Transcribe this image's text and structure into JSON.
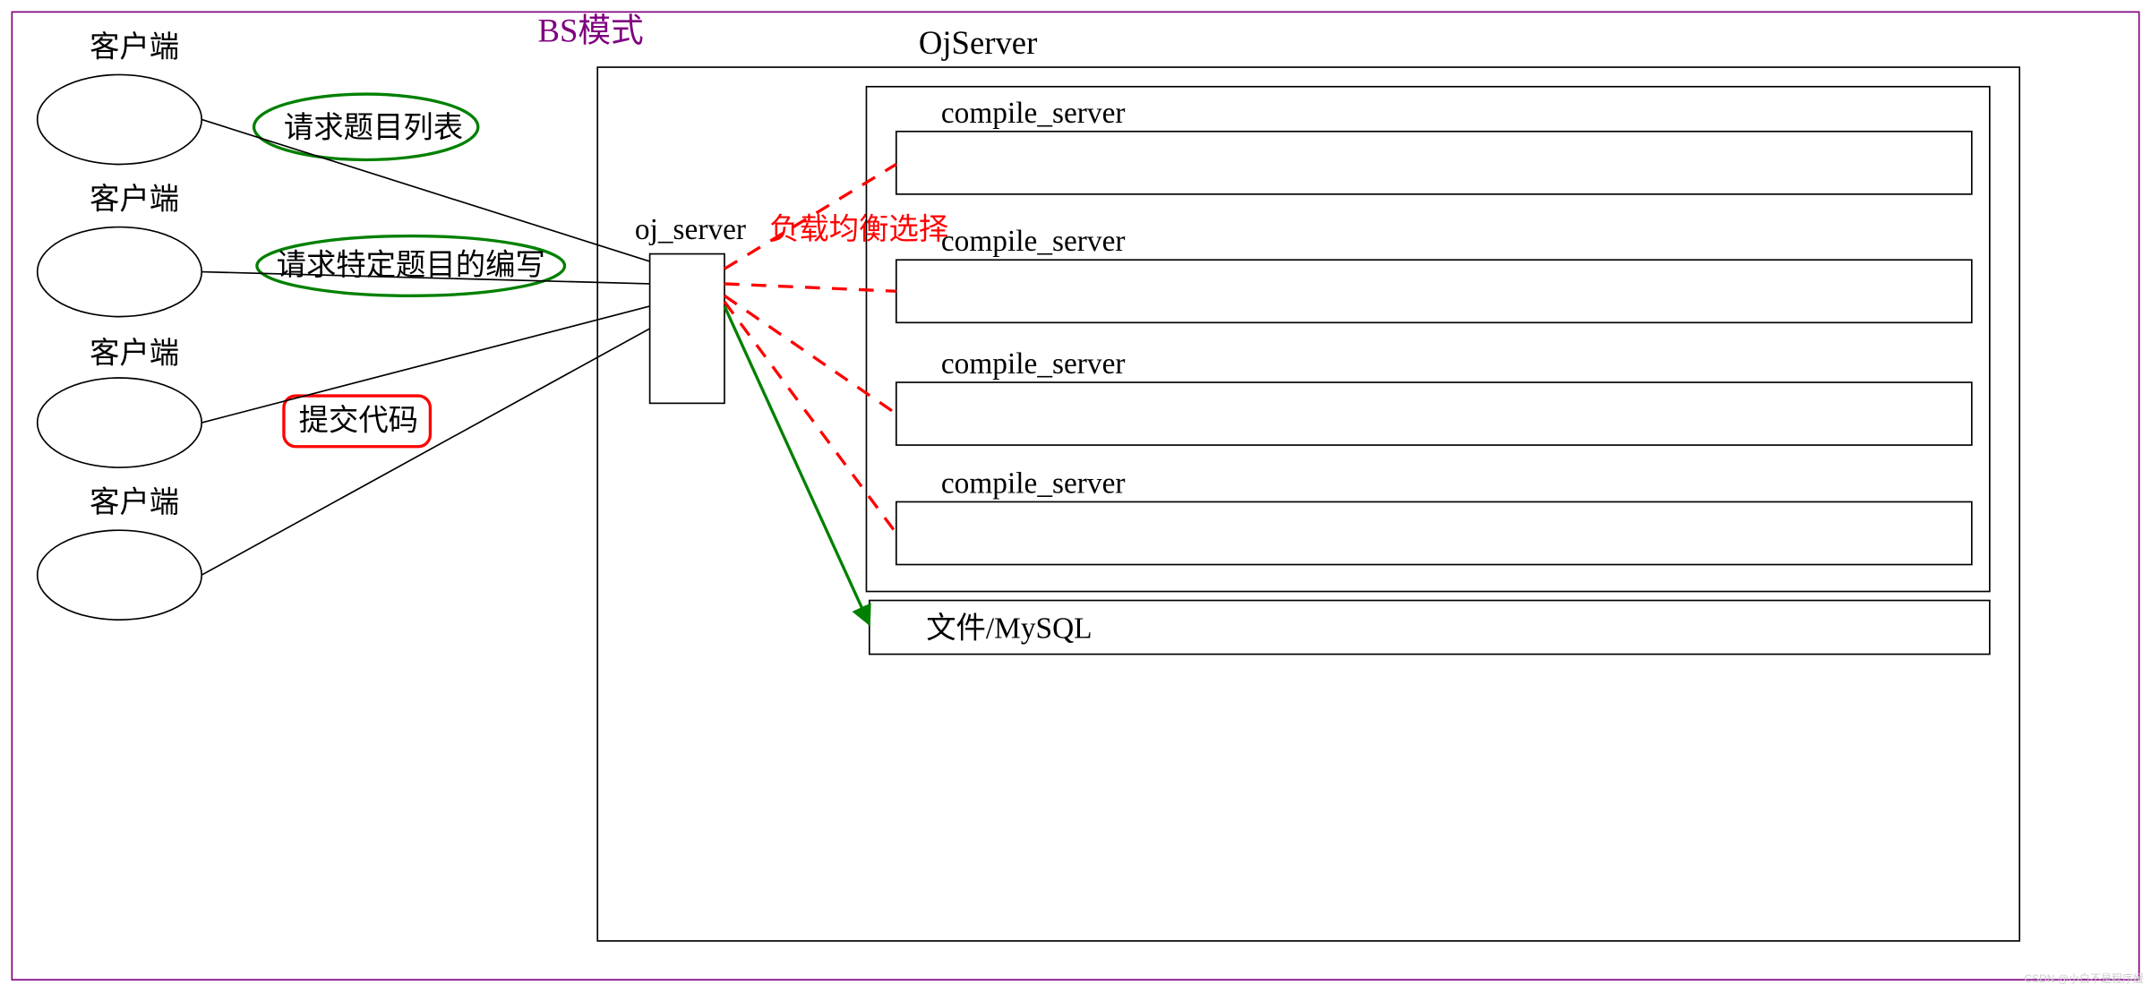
{
  "title": "BS模式",
  "clients": {
    "label": "客户端",
    "count": 4
  },
  "requests": {
    "list": "请求题目列表",
    "detail": "请求特定题目的编写",
    "submit": "提交代码"
  },
  "ojserver": {
    "outer_label": "OjServer",
    "oj_server": "oj_server",
    "balance": "负载均衡选择",
    "compile": "compile_server",
    "compile_count": 4,
    "storage": "文件/MySQL"
  },
  "watermark": "CSDN @小白不是程序媛",
  "colors": {
    "frame": "#800080",
    "title": "#800080",
    "green": "#008000",
    "red": "#ff0000",
    "black": "#000000"
  }
}
